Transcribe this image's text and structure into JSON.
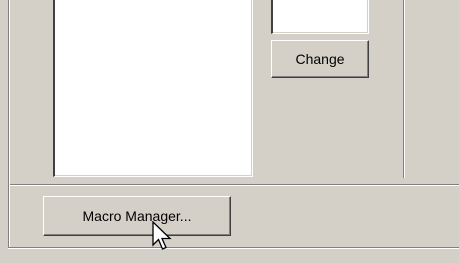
{
  "buttons": {
    "change_label": "Change",
    "macro_manager_label_pre": "Macro Mana",
    "macro_manager_label_underlined": "g",
    "macro_manager_label_post": "er..."
  },
  "icons": {
    "cursor": "arrow-pointer-icon"
  },
  "colors": {
    "dialog_face": "#d4d0c8",
    "field_background": "#ffffff",
    "shadow": "#808080",
    "dark_shadow": "#404040",
    "highlight": "#ffffff"
  }
}
